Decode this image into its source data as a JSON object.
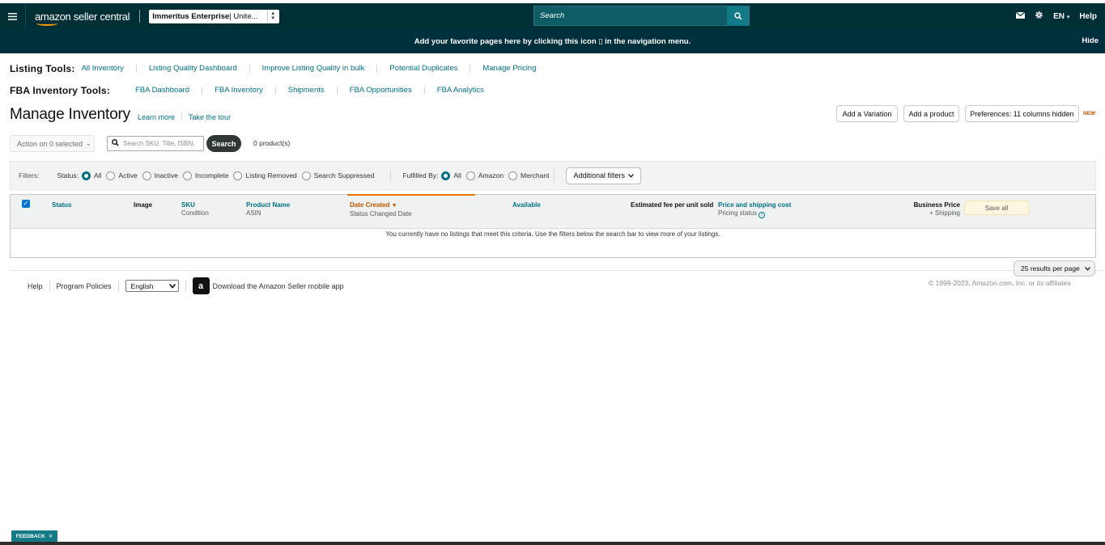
{
  "topbar": {
    "logo_text": "amazon seller central",
    "account_name": "Immeritus Enterprise",
    "account_region": " | Unite...",
    "search_placeholder": "Search",
    "language": "EN",
    "help": "Help"
  },
  "hint_bar": {
    "message": "Add your favorite pages here by clicking this icon ▯ in the navigation menu.",
    "hide": "Hide"
  },
  "listing_tools": {
    "label": "Listing Tools:",
    "links": [
      "All Inventory",
      "Listing Quality Dashboard",
      "Improve Listing Quality in bulk",
      "Potential Duplicates",
      "Manage Pricing"
    ]
  },
  "fba_tools": {
    "label": "FBA Inventory Tools:",
    "links": [
      "FBA Dashboard",
      "FBA Inventory",
      "Shipments",
      "FBA Opportunities",
      "FBA Analytics"
    ]
  },
  "page": {
    "title": "Manage Inventory",
    "learn_more": "Learn more",
    "take_tour": "Take the tour",
    "add_variation": "Add a Variation",
    "add_product": "Add a product",
    "preferences": "Preferences: 11 columns hidden",
    "new_badge": "NEW"
  },
  "action_row": {
    "action_select": "Action on 0 selected",
    "search_placeholder": "Search SKU, Title, ISBN,",
    "search_button": "Search",
    "product_count": "0 product(s)"
  },
  "filters": {
    "label": "Filters:",
    "status_label": "Status:",
    "status_options": [
      "All",
      "Active",
      "Inactive",
      "Incomplete",
      "Listing Removed",
      "Search Suppressed"
    ],
    "status_selected": "All",
    "fulfilled_label": "Fulfilled By:",
    "fulfilled_options": [
      "All",
      "Amazon",
      "Merchant"
    ],
    "fulfilled_selected": "All",
    "additional": "Additional filters"
  },
  "table": {
    "columns": {
      "status": "Status",
      "image": "Image",
      "sku": "SKU",
      "sku_sub": "Condition",
      "product_name": "Product Name",
      "product_sub": "ASIN",
      "date_created": "Date Created",
      "date_sub": "Status Changed Date",
      "available": "Available",
      "est_fee": "Estimated fee per unit sold",
      "price": "Price and shipping cost",
      "price_sub": "Pricing status",
      "business_price": "Business Price",
      "business_sub": "+ Shipping"
    },
    "save_all": "Save all",
    "empty_message": "You currently have no listings that meet this criteria. Use the filters below the search bar to view more of your listings."
  },
  "pagination": {
    "results_per_page": "25 results per page"
  },
  "footer": {
    "help": "Help",
    "program_policies": "Program Policies",
    "language": "English",
    "app_download": "Download the Amazon Seller mobile app",
    "copyright": "© 1999-2023, Amazon.com, Inc. or its affiliates"
  },
  "feedback": "FEEDBACK",
  "colors": {
    "topbar": "#002f36",
    "link": "#007185",
    "accent_orange": "#e77600"
  }
}
